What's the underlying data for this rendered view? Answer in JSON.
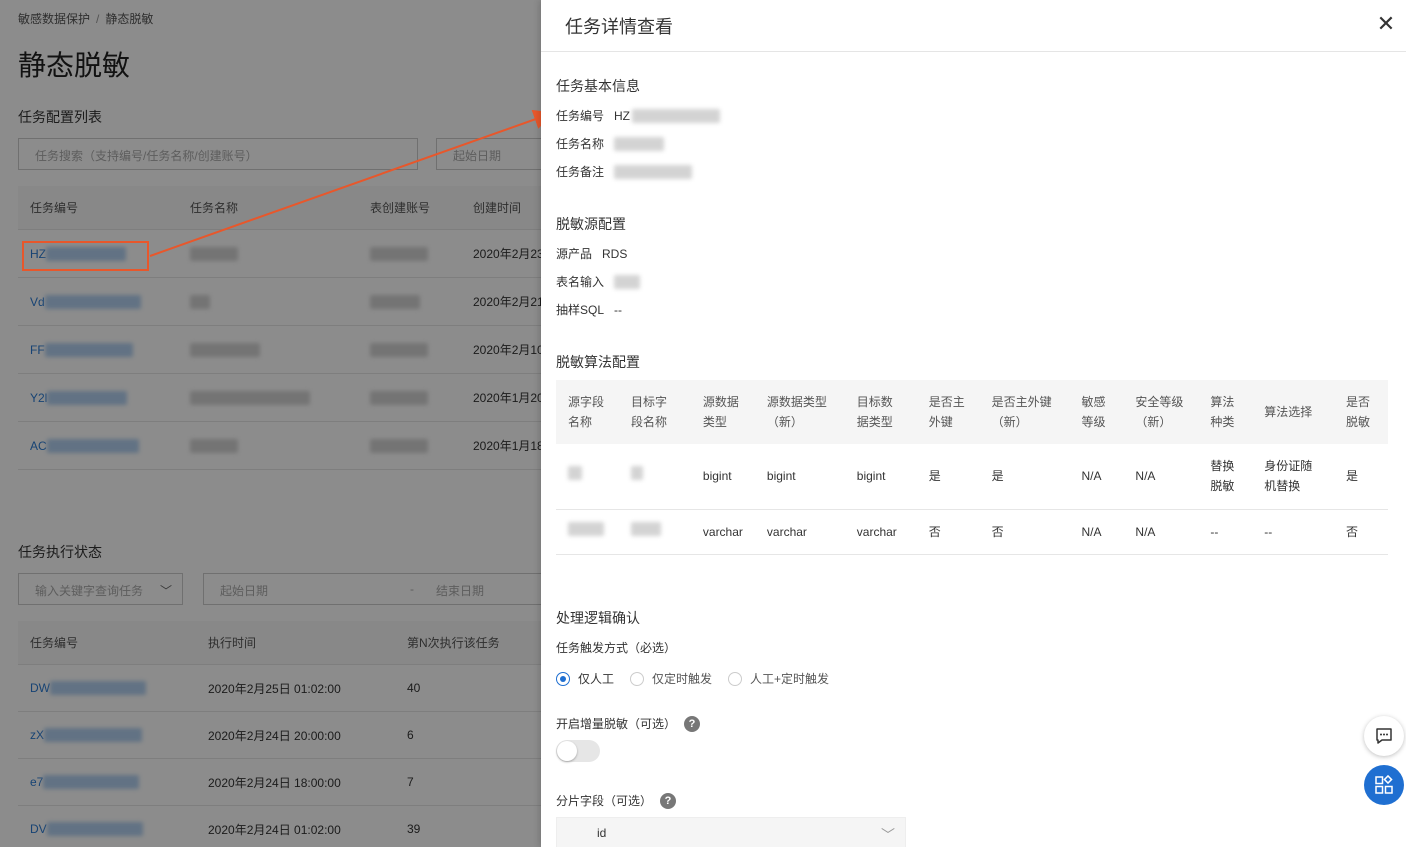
{
  "breadcrumb": {
    "parent": "敏感数据保护",
    "separator": "/",
    "current": "静态脱敏"
  },
  "page": {
    "title": "静态脱敏"
  },
  "task_config": {
    "section_title": "任务配置列表",
    "search_placeholder": "任务搜索（支持编号/任务名称/创建账号）",
    "start_date_placeholder": "起始日期",
    "columns": [
      "任务编号",
      "任务名称",
      "表创建账号",
      "创建时间"
    ],
    "rows": [
      {
        "id_prefix": "HZ",
        "time": "2020年2月23"
      },
      {
        "id_prefix": "Vd",
        "time": "2020年2月21"
      },
      {
        "id_prefix": "FF",
        "time": "2020年2月10"
      },
      {
        "id_prefix": "Y2l",
        "time": "2020年1月20"
      },
      {
        "id_prefix": "AC",
        "time": "2020年1月18"
      }
    ]
  },
  "task_exec": {
    "section_title": "任务执行状态",
    "keyword_placeholder": "输入关键字查询任务",
    "start_date_placeholder": "起始日期",
    "date_sep": "-",
    "end_date_placeholder": "结束日期",
    "columns": [
      "任务编号",
      "执行时间",
      "第N次执行该任务"
    ],
    "rows": [
      {
        "id_prefix": "DW",
        "time": "2020年2月25日 01:02:00",
        "count": "40"
      },
      {
        "id_prefix": "zX",
        "time": "2020年2月24日 20:00:00",
        "count": "6"
      },
      {
        "id_prefix": "e7",
        "time": "2020年2月24日 18:00:00",
        "count": "7"
      },
      {
        "id_prefix": "DV",
        "time": "2020年2月24日 01:02:00",
        "count": "39"
      }
    ]
  },
  "drawer": {
    "title": "任务详情查看",
    "close_label": "✕",
    "basic": {
      "title": "任务基本信息",
      "id_label": "任务编号",
      "id_value": "HZ",
      "name_label": "任务名称",
      "remark_label": "任务备注"
    },
    "source": {
      "title": "脱敏源配置",
      "product_label": "源产品",
      "product_value": "RDS",
      "table_label": "表名输入",
      "sql_label": "抽样SQL",
      "sql_value": "--"
    },
    "algo": {
      "title": "脱敏算法配置",
      "columns": [
        "源字段名称",
        "目标字段名称",
        "源数据类型",
        "源数据类型（新）",
        "目标数据类型",
        "是否主外键",
        "是否主外键（新）",
        "敏感等级",
        "安全等级（新）",
        "算法种类",
        "算法选择",
        "是否脱敏"
      ],
      "rows": [
        {
          "src_type": "bigint",
          "src_type_new": "bigint",
          "tgt_type": "bigint",
          "pk": "是",
          "pk_new": "是",
          "sens": "N/A",
          "sec": "N/A",
          "algo_kind": "替换脱敏",
          "algo_sel": "身份证随机替换",
          "mask": "是"
        },
        {
          "src_type": "varchar",
          "src_type_new": "varchar",
          "tgt_type": "varchar",
          "pk": "否",
          "pk_new": "否",
          "sens": "N/A",
          "sec": "N/A",
          "algo_kind": "--",
          "algo_sel": "--",
          "mask": "否"
        }
      ]
    },
    "logic": {
      "title": "处理逻辑确认",
      "trigger_label": "任务触发方式（必选）",
      "trigger_options": [
        "仅人工",
        "仅定时触发",
        "人工+定时触发"
      ],
      "trigger_selected": "仅人工",
      "incremental_label": "开启增量脱敏（可选）",
      "incremental_on": false,
      "shard_label": "分片字段（可选）",
      "shard_value": "id"
    }
  },
  "colors": {
    "accent": "#1f6fd1",
    "highlight": "#e8572b",
    "link": "#2a7bd3"
  },
  "icons": {
    "chat": "chat-icon",
    "apps": "apps-icon",
    "help": "help-icon"
  }
}
